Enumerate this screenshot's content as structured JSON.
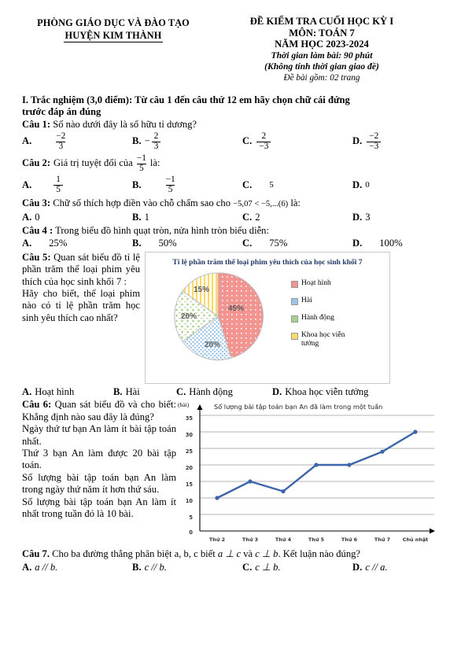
{
  "header": {
    "left_line1": "PHÒNG GIÁO DỤC VÀ ĐÀO TẠO",
    "left_line2": "HUYỆN KIM THÀNH",
    "right_line1": "ĐỀ KIỂM TRA CUỐI HỌC KỲ I",
    "right_line2": "MÔN: TOÁN 7",
    "right_line3": "NĂM HỌC 2023-2024",
    "right_line4": "Thời gian làm bài: 90 phút",
    "right_line5": "(Không tính thời gian giao đề)",
    "right_line6": "Đề bài gồm: 02 trang"
  },
  "section": {
    "title_line1": "I. Trắc nghiệm (3,0 điểm): Từ câu 1 đến câu thứ 12 em hãy chọn chữ cái đứng",
    "title_line2": "trước đáp án đúng"
  },
  "q1": {
    "label": "Câu 1:",
    "text": "Số nào dưới đây là số hữu tỉ dương?",
    "options": [
      {
        "label": "A.",
        "num": "−2",
        "den": "3",
        "minus_before": ""
      },
      {
        "label": "B.",
        "num": "2",
        "den": "3",
        "minus_before": "−"
      },
      {
        "label": "C.",
        "num": "2",
        "den": "−3",
        "minus_before": ""
      },
      {
        "label": "D.",
        "num": "−2",
        "den": "−3",
        "minus_before": ""
      }
    ]
  },
  "q2": {
    "label": "Câu 2:",
    "text_before": "Giá trị tuyệt đối của",
    "frac_num": "−1",
    "frac_den": "5",
    "text_after": "là:",
    "options": [
      {
        "label": "A.",
        "type": "frac",
        "num": "1",
        "den": "5",
        "value": ""
      },
      {
        "label": "B.",
        "type": "frac",
        "num": "−1",
        "den": "5",
        "value": ""
      },
      {
        "label": "C.",
        "type": "plain",
        "num": "",
        "den": "",
        "value": "5"
      },
      {
        "label": "D.",
        "type": "plain",
        "num": "",
        "den": "",
        "value": "0"
      }
    ]
  },
  "q3": {
    "label": "Câu 3:",
    "text_before": "Chữ số thích hợp điền vào chỗ chấm sao cho",
    "math": "−5,07 < −5,...(6)",
    "text_after": "là:",
    "options": [
      {
        "label": "A.",
        "value": "0"
      },
      {
        "label": "B.",
        "value": "1"
      },
      {
        "label": "C.",
        "value": "2"
      },
      {
        "label": "D.",
        "value": "3"
      }
    ]
  },
  "q4": {
    "label": "Câu 4 :",
    "text": "Trong biểu đồ hình quạt tròn, nửa hình tròn biểu diễn:",
    "options": [
      {
        "label": "A.",
        "value": "25%"
      },
      {
        "label": "B.",
        "value": "50%"
      },
      {
        "label": "C.",
        "value": "75%"
      },
      {
        "label": "D.",
        "value": "100%"
      }
    ]
  },
  "q5": {
    "label": "Câu 5:",
    "text": "Quan sát biểu đồ tỉ lệ phần trăm thể loại phim yêu thích của  học sinh khối 7 :",
    "text2": "Hãy cho biết, thể loại phim nào có tỉ lệ phần trăm học sinh yêu thích cao nhất?",
    "options": [
      {
        "label": "A.",
        "value": "Hoạt hình"
      },
      {
        "label": "B.",
        "value": "Hài"
      },
      {
        "label": "C.",
        "value": "Hành động"
      },
      {
        "label": "D.",
        "value": "Khoa học viễn tưởng"
      }
    ]
  },
  "q6": {
    "label": "Câu 6:",
    "text": "Quan sát biểu đồ và cho biết: Khẳng định nào sau đây là đúng?",
    "options": [
      {
        "label": "A.",
        "value": "Ngày thứ tư bạn An làm ít bài tập toán nhất."
      },
      {
        "label": "B.",
        "value": "Thứ 3 bạn An làm được 20 bài tập toán."
      },
      {
        "label": "C.",
        "value": "Số lượng bài tập toán bạn An làm trong ngày thứ năm ít hơn thứ sáu."
      },
      {
        "label": "D.",
        "value": "Số lượng bài tập toán bạn An làm ít nhất trong tuần đó là 10 bài."
      }
    ]
  },
  "q7": {
    "label": "Câu 7.",
    "text_before": "Cho ba đường thẳng phân biệt a, b, c biết",
    "math1": "a ⊥ c",
    "mid": "và",
    "math2": "c ⊥ b",
    "text_after": ". Kết luận nào đúng?",
    "options": [
      {
        "label": "A.",
        "value": "a // b."
      },
      {
        "label": "B.",
        "value": "c // b."
      },
      {
        "label": "C.",
        "value": "c ⊥ b."
      },
      {
        "label": "D.",
        "value": "c // a."
      }
    ]
  },
  "chart_data": [
    {
      "type": "pie",
      "title": "Tỉ lệ phần trăm thể loại phim yêu thích của học sinh khối 7",
      "categories": [
        "Hoạt hình",
        "Hài",
        "Hành động",
        "Khoa học viễn tưởng"
      ],
      "values": [
        45,
        20,
        20,
        15
      ],
      "data_labels": [
        "45%",
        "20%",
        "20%",
        "15%"
      ],
      "colors": [
        "#F2948F",
        "#9DC3E6",
        "#A9D18E",
        "#FFD966"
      ],
      "legend_position": "right",
      "legend_labels": [
        "Hoạt hình",
        "Hài",
        "Hành động",
        "Khoa học viễn\ntưởng"
      ]
    },
    {
      "type": "line",
      "title": "Số lượng bài tập toán bạn An đã làm trong một tuần",
      "ylabel": "(bài)",
      "xlabel": "",
      "categories": [
        "Thứ 2",
        "Thứ 3",
        "Thứ 4",
        "Thứ 5",
        "Thứ 6",
        "Thứ 7",
        "Chủ nhật"
      ],
      "values": [
        10,
        15,
        12,
        20,
        20,
        24,
        30
      ],
      "yticks": [
        0,
        5,
        10,
        15,
        20,
        25,
        30,
        35
      ],
      "ylim": [
        0,
        37
      ],
      "grid": true,
      "series_color": "#3C64A8",
      "legend_position": "none"
    }
  ]
}
